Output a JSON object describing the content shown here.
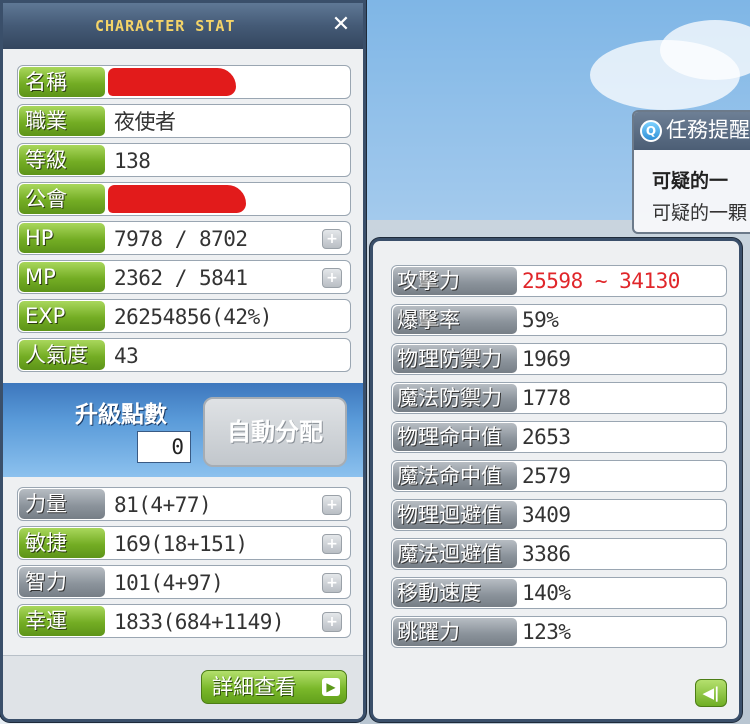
{
  "stat_window": {
    "title": "CHARACTER STAT",
    "close_label": "✕",
    "rows": [
      {
        "label": "名稱",
        "value": "",
        "redacted": true,
        "label_style": "green"
      },
      {
        "label": "職業",
        "value": "夜使者",
        "label_style": "green"
      },
      {
        "label": "等級",
        "value": "138",
        "label_style": "green"
      },
      {
        "label": "公會",
        "value": "",
        "redacted": true,
        "label_style": "green"
      },
      {
        "label": "HP",
        "value": "7978 / 8702",
        "label_style": "green",
        "plus": true
      },
      {
        "label": "MP",
        "value": "2362 / 5841",
        "label_style": "green",
        "plus": true
      },
      {
        "label": "EXP",
        "value": "26254856(42%)",
        "label_style": "green"
      },
      {
        "label": "人氣度",
        "value": "43",
        "label_style": "green"
      }
    ],
    "ability_points": {
      "label": "升級點數",
      "value": "0",
      "auto_assign_label": "自動分配"
    },
    "attributes": [
      {
        "label": "力量",
        "value": "81(4+77)",
        "label_style": "gray"
      },
      {
        "label": "敏捷",
        "value": "169(18+151)",
        "label_style": "green"
      },
      {
        "label": "智力",
        "value": "101(4+97)",
        "label_style": "gray"
      },
      {
        "label": "幸運",
        "value": "1833(684+1149)",
        "label_style": "green"
      }
    ],
    "detail_button_label": "詳細查看",
    "detail_button_arrow": "▶"
  },
  "quest_window": {
    "icon_text": "Q",
    "title": "任務提醒",
    "line1": "可疑的一",
    "line2": "可疑的一顆"
  },
  "detail_window": {
    "rows": [
      {
        "label": "攻擊力",
        "value": "25598 ~ 34130",
        "highlight": true
      },
      {
        "label": "爆擊率",
        "value": "59%"
      },
      {
        "label": "物理防禦力",
        "value": "1969"
      },
      {
        "label": "魔法防禦力",
        "value": "1778"
      },
      {
        "label": "物理命中值",
        "value": "2653"
      },
      {
        "label": "魔法命中值",
        "value": "2579"
      },
      {
        "label": "物理迴避值",
        "value": "3409"
      },
      {
        "label": "魔法迴避值",
        "value": "3386"
      },
      {
        "label": "移動速度",
        "value": "140%"
      },
      {
        "label": "跳躍力",
        "value": "123%"
      }
    ],
    "back_button_label": "◀|"
  },
  "colors": {
    "label_green": "#74ad24",
    "label_gray": "#8c949c",
    "highlight_red": "#e0262a",
    "title_gold": "#f4d468",
    "redaction": "#e21b1b"
  }
}
